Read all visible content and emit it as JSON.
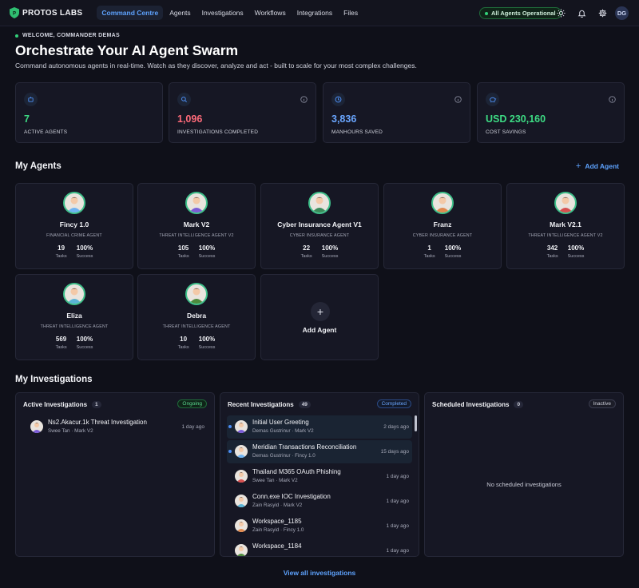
{
  "brand": {
    "name": "PROTOS LABS"
  },
  "nav": [
    {
      "label": "Command Centre",
      "active": true
    },
    {
      "label": "Agents"
    },
    {
      "label": "Investigations"
    },
    {
      "label": "Workflows"
    },
    {
      "label": "Integrations"
    },
    {
      "label": "Files"
    }
  ],
  "status": {
    "label": "All Agents Operational",
    "color": "#33d17a"
  },
  "user": {
    "initials": "DG"
  },
  "header": {
    "welcome": "WELCOME, COMMANDER DEMAS",
    "title": "Orchestrate Your AI Agent Swarm",
    "subtitle": "Command autonomous agents in real-time. Watch as they discover, analyze and act - built to scale for your most complex challenges."
  },
  "stats": [
    {
      "value": "7",
      "label": "ACTIVE AGENTS",
      "color": "#3ddc84",
      "icon": "robot-icon"
    },
    {
      "value": "1,096",
      "label": "INVESTIGATIONS COMPLETED",
      "color": "#ff6b7a",
      "icon": "search-icon"
    },
    {
      "value": "3,836",
      "label": "MANHOURS SAVED",
      "color": "#6aa6ff",
      "icon": "clock-icon"
    },
    {
      "value": "USD 230,160",
      "label": "COST SAVINGS",
      "color": "#3ddc84",
      "icon": "piggy-bank-icon"
    }
  ],
  "agents_section": {
    "title": "My Agents",
    "add_label": "Add Agent"
  },
  "agents": [
    {
      "name": "Fincy 1.0",
      "role": "FINANCIAL CRIME AGENT",
      "tasks": "19",
      "success": "100%",
      "tasks_label": "Tasks",
      "success_label": "Success"
    },
    {
      "name": "Mark V2",
      "role": "THREAT INTELLIGENCE AGENT V2",
      "tasks": "105",
      "success": "100%",
      "tasks_label": "Tasks",
      "success_label": "Success"
    },
    {
      "name": "Cyber Insurance Agent V1",
      "role": "CYBER INSURANCE AGENT",
      "tasks": "22",
      "success": "100%",
      "tasks_label": "Tasks",
      "success_label": "Success"
    },
    {
      "name": "Franz",
      "role": "CYBER INSURANCE AGENT",
      "tasks": "1",
      "success": "100%",
      "tasks_label": "Tasks",
      "success_label": "Success"
    },
    {
      "name": "Mark V2.1",
      "role": "THREAT INTELLIGENCE AGENT V2",
      "tasks": "342",
      "success": "100%",
      "tasks_label": "Tasks",
      "success_label": "Success"
    },
    {
      "name": "Eliza",
      "role": "THREAT INTELLIGENCE AGENT",
      "tasks": "569",
      "success": "100%",
      "tasks_label": "Tasks",
      "success_label": "Success"
    },
    {
      "name": "Debra",
      "role": "THREAT INTELLIGENCE AGENT",
      "tasks": "10",
      "success": "100%",
      "tasks_label": "Tasks",
      "success_label": "Success"
    }
  ],
  "add_agent_card": {
    "label": "Add Agent"
  },
  "investigations_section": {
    "title": "My Investigations"
  },
  "active": {
    "title": "Active Investigations",
    "count": "1",
    "badge": "Ongoing",
    "items": [
      {
        "title": "Ns2.Akacur.1k Threat Investigation",
        "sub": "Swee Tan · Mark V2",
        "date": "1 day ago"
      }
    ]
  },
  "recent": {
    "title": "Recent Investigations",
    "count": "49",
    "badge": "Completed",
    "items": [
      {
        "title": "Initial User Greeting",
        "sub": "Demas Gustrinur · Mark V2",
        "date": "2 days ago"
      },
      {
        "title": "Meridian Transactions Reconciliation",
        "sub": "Demas Gustrinur · Fincy 1.0",
        "date": "15 days ago"
      },
      {
        "title": "Thailand M365 OAuth Phishing",
        "sub": "Swee Tan · Mark V2",
        "date": "1 day ago"
      },
      {
        "title": "Conn.exe IOC Investigation",
        "sub": "Zain Rasyid · Mark V2",
        "date": "1 day ago"
      },
      {
        "title": "Workspace_1185",
        "sub": "Zain Rasyid · Fincy 1.0",
        "date": "1 day ago"
      },
      {
        "title": "Workspace_1184",
        "sub": "",
        "date": "1 day ago"
      }
    ]
  },
  "scheduled": {
    "title": "Scheduled Investigations",
    "count": "0",
    "badge": "Inactive",
    "empty": "No scheduled investigations"
  },
  "footer": {
    "view_all": "View all investigations"
  }
}
